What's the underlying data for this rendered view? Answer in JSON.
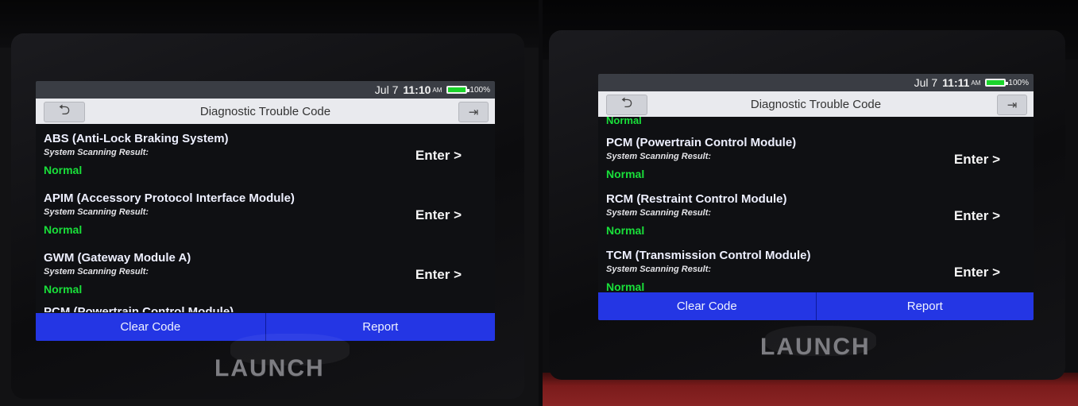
{
  "left": {
    "status": {
      "date": "Jul 7",
      "time": "11:10",
      "ampm": "AM",
      "battery_pct": "100%"
    },
    "title": "Diagnostic Trouble Code",
    "items": [
      {
        "name": "ABS (Anti-Lock Braking System)",
        "label": "System Scanning Result:",
        "status": "Normal",
        "action": "Enter >"
      },
      {
        "name": "APIM (Accessory Protocol Interface Module)",
        "label": "System Scanning Result:",
        "status": "Normal",
        "action": "Enter >"
      },
      {
        "name": "GWM (Gateway Module A)",
        "label": "System Scanning Result:",
        "status": "Normal",
        "action": "Enter >"
      }
    ],
    "partial_next_item": "PCM (Powertrain Control Module)",
    "buttons": {
      "clear": "Clear Code",
      "report": "Report"
    },
    "logo": "LAUNCH"
  },
  "right": {
    "status": {
      "date": "Jul 7",
      "time": "11:11",
      "ampm": "AM",
      "battery_pct": "100%"
    },
    "title": "Diagnostic Trouble Code",
    "partial_prev_status": "Normal",
    "items": [
      {
        "name": "PCM (Powertrain Control Module)",
        "label": "System Scanning Result:",
        "status": "Normal",
        "action": "Enter >"
      },
      {
        "name": "RCM (Restraint Control Module)",
        "label": "System Scanning Result:",
        "status": "Normal",
        "action": "Enter >"
      },
      {
        "name": "TCM (Transmission Control Module)",
        "label": "System Scanning Result:",
        "status": "Normal",
        "action": "Enter >"
      }
    ],
    "buttons": {
      "clear": "Clear Code",
      "report": "Report"
    },
    "logo": "LAUNCH"
  },
  "icons": {
    "back": "back-arrow-icon",
    "exit": "exit-icon",
    "battery": "battery-icon"
  },
  "colors": {
    "action_bar": "#2436e4",
    "status_normal": "#19e03a",
    "title_bar": "#e9eaee"
  }
}
